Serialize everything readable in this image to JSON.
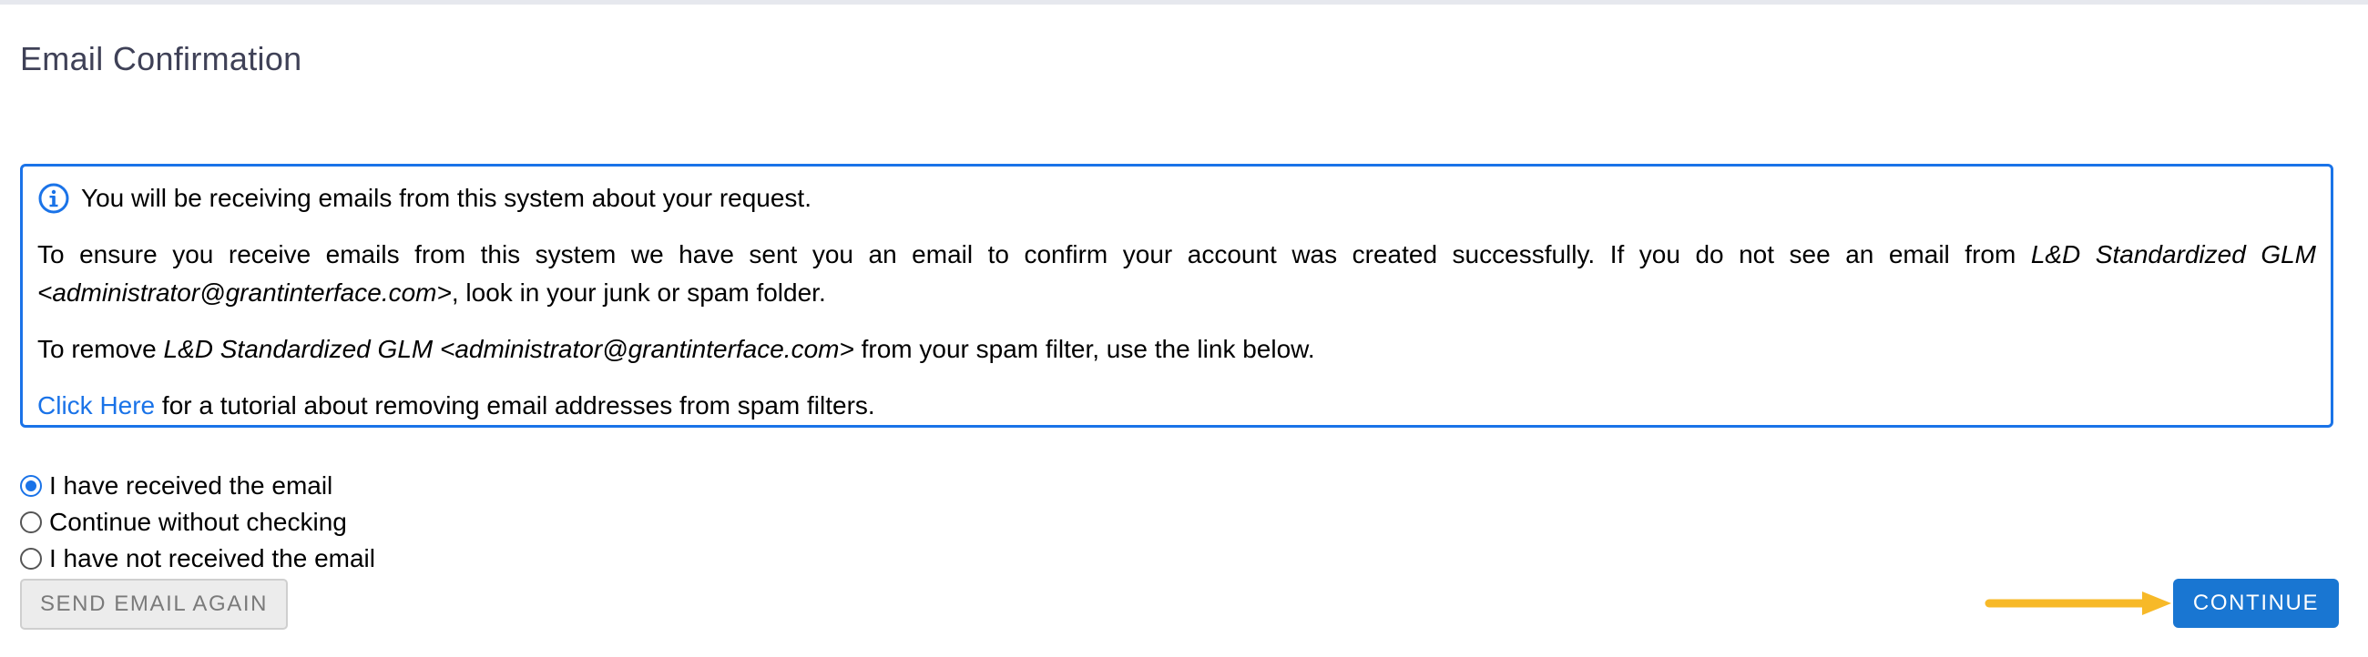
{
  "page": {
    "title": "Email Confirmation"
  },
  "info_box": {
    "icon": "info-icon",
    "headline": "You will be receiving emails from this system about your request.",
    "para1_part1": "To ensure you receive emails from this system we have sent you an email to confirm your account was created successfully. If you do not see an email from ",
    "para1_sender": "L&D Standardized GLM <administrator@grantinterface.com>",
    "para1_part2": ", look in your junk or spam folder.",
    "para2_part1": "To remove ",
    "para2_sender": "L&D Standardized GLM <administrator@grantinterface.com>",
    "para2_part2": " from your spam filter, use the link below.",
    "link_text": "Click Here",
    "link_suffix": " for a tutorial about removing email addresses from spam filters."
  },
  "options": [
    {
      "label": "I have received the email",
      "checked": true
    },
    {
      "label": "Continue without checking",
      "checked": false
    },
    {
      "label": "I have not received the email",
      "checked": false
    }
  ],
  "buttons": {
    "send_again": "SEND EMAIL AGAIN",
    "continue": "CONTINUE"
  },
  "colors": {
    "accent": "#1a73e8",
    "primary_button": "#1976d2",
    "arrow": "#f7b928",
    "title": "#3f4157"
  }
}
